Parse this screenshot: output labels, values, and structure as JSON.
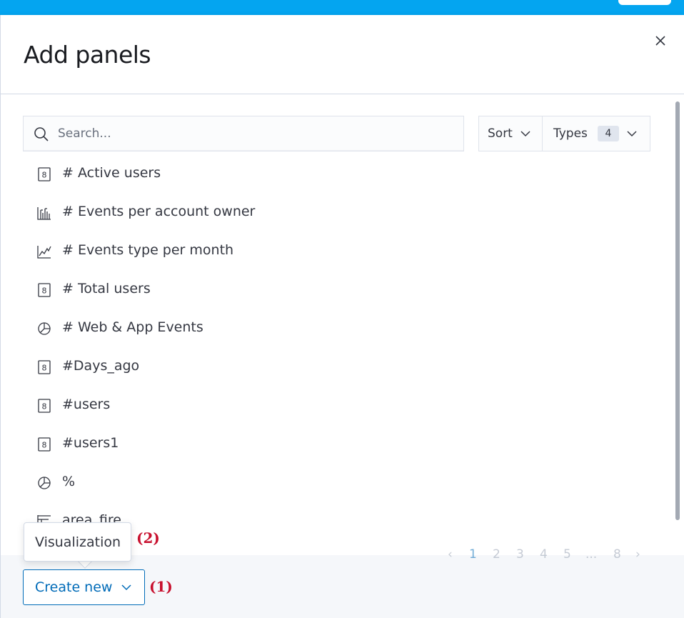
{
  "flyout": {
    "title": "Add panels"
  },
  "search": {
    "placeholder": "Search..."
  },
  "filters": {
    "sort_label": "Sort",
    "types_label": "Types",
    "types_count": "4"
  },
  "items": [
    {
      "label": "# Active users",
      "icon": "metric-icon"
    },
    {
      "label": "# Events per account owner",
      "icon": "bar-chart-icon"
    },
    {
      "label": "# Events type per month",
      "icon": "line-chart-icon"
    },
    {
      "label": "# Total users",
      "icon": "metric-icon"
    },
    {
      "label": "# Web & App Events",
      "icon": "pie-chart-icon"
    },
    {
      "label": "#Days_ago",
      "icon": "metric-icon"
    },
    {
      "label": "#users",
      "icon": "metric-icon"
    },
    {
      "label": "#users1",
      "icon": "metric-icon"
    },
    {
      "label": "%",
      "icon": "pie-chart-icon"
    },
    {
      "label": "area_fire",
      "icon": "table-icon"
    }
  ],
  "pagination": {
    "pages": [
      "1",
      "2",
      "3",
      "4",
      "5",
      "...",
      "8"
    ],
    "active": "1"
  },
  "footer": {
    "create_new_label": "Create new"
  },
  "tooltip": {
    "label": "Visualization"
  },
  "annotations": {
    "one": "(1)",
    "two": "(2)"
  },
  "colors": {
    "topbar": "#04a5f0",
    "primary": "#006bb8",
    "annotation": "#c8102e"
  }
}
